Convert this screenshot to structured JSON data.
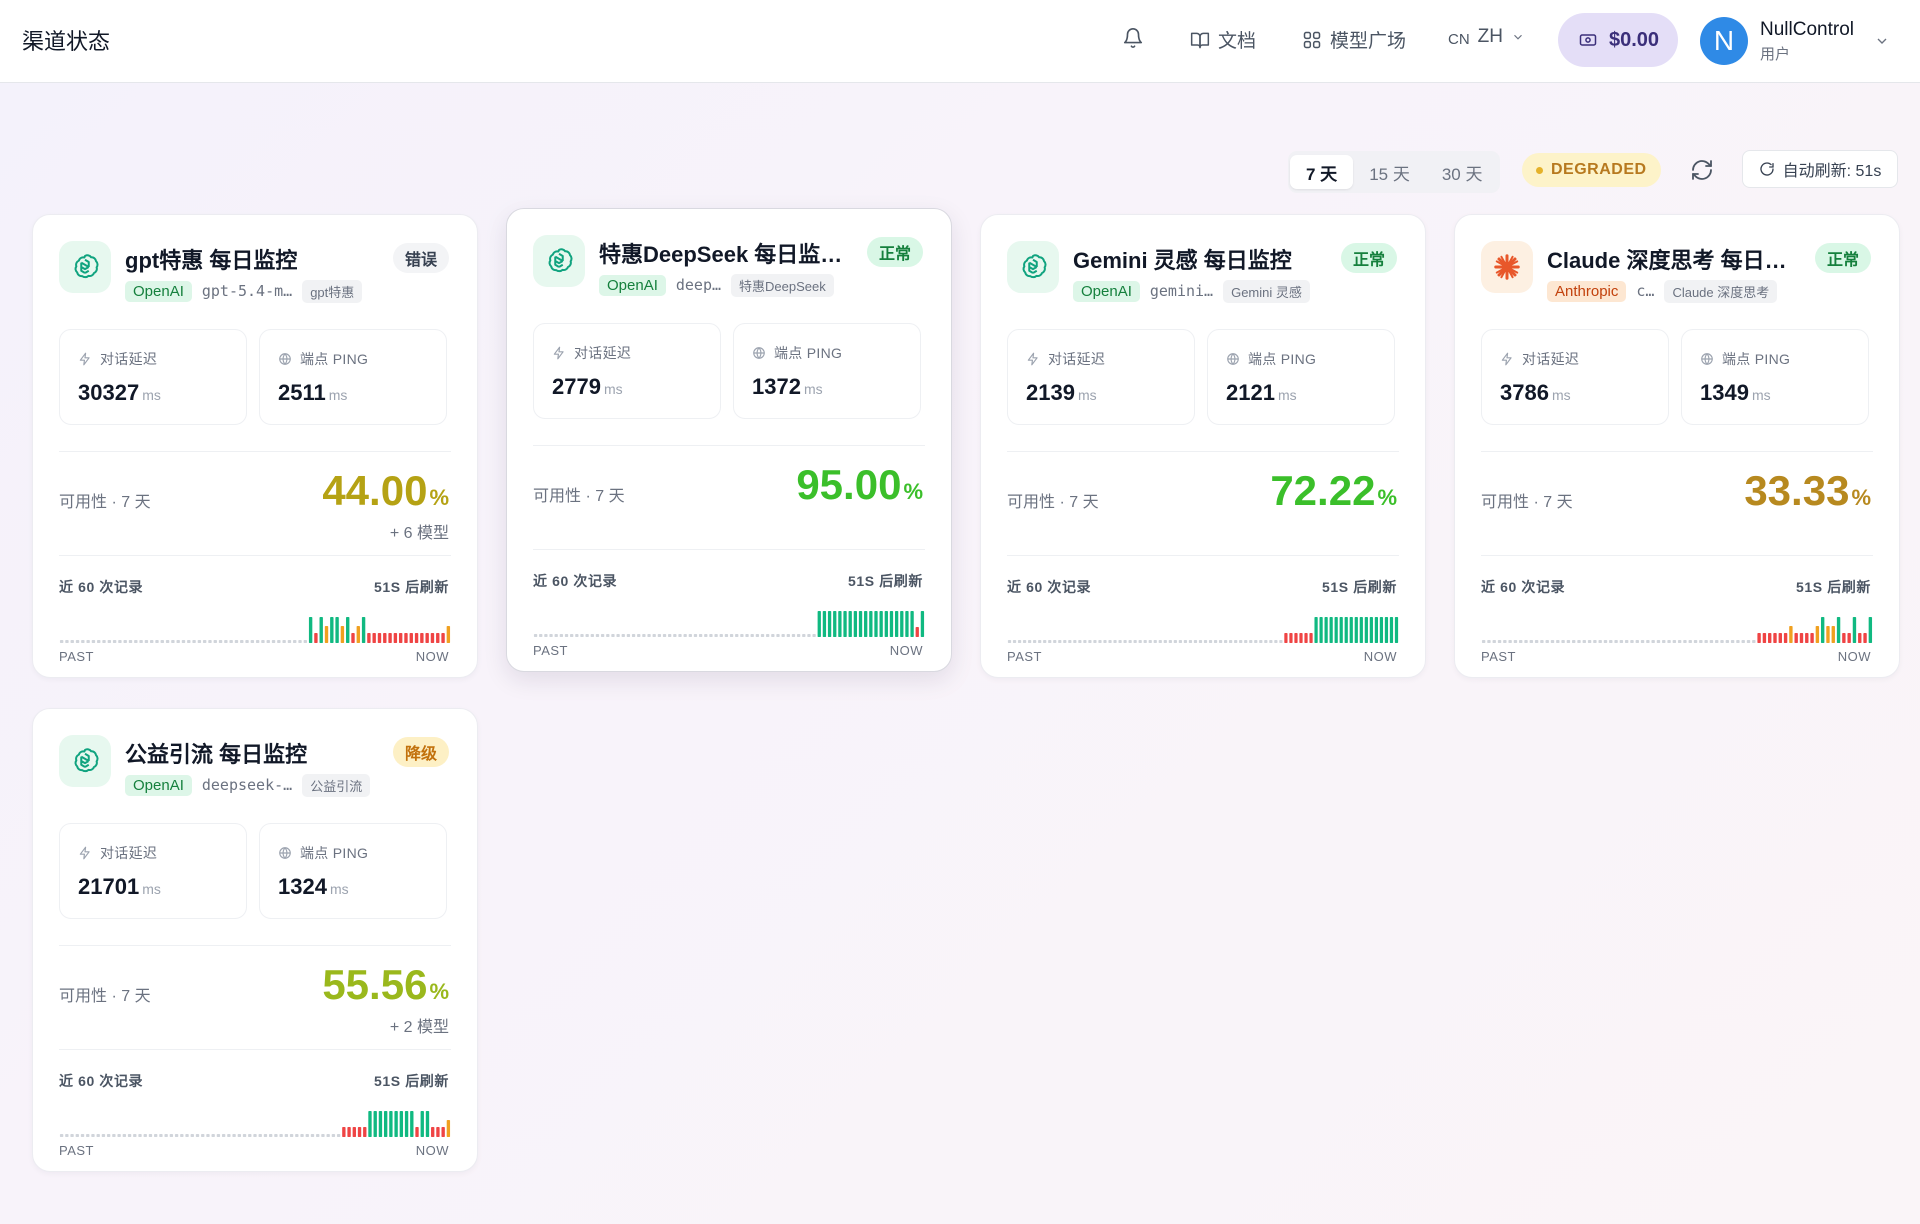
{
  "header": {
    "title": "渠道状态",
    "docs_label": "文档",
    "models_label": "模型广场",
    "lang_prefix": "CN",
    "lang_label": "ZH",
    "balance": "$0.00",
    "user_initial": "N",
    "user_name": "NullControl",
    "user_role": "用户"
  },
  "controls": {
    "ranges": [
      "7 天",
      "15 天",
      "30 天"
    ],
    "active_range": 0,
    "overall_status": "DEGRADED",
    "auto_refresh": "自动刷新: 51s"
  },
  "common": {
    "latency_label": "对话延迟",
    "ping_label": "端点 PING",
    "unit": "ms",
    "availability_label": "可用性 · 7 天",
    "records_label": "近 60 次记录",
    "refresh_label": "51S 后刷新",
    "past": "PAST",
    "now": "NOW",
    "pct": "%"
  },
  "colors": {
    "ok": "#10b981",
    "warn": "#f0a020",
    "error": "#ef4444",
    "empty": "#d1d5db"
  },
  "cards": [
    {
      "title": "gpt特惠 每日监控",
      "status": "错误",
      "status_type": "error",
      "provider": "OpenAI",
      "provider_type": "openai",
      "model": "gpt-5.4-m…",
      "channel": "gpt特惠",
      "latency": "30327",
      "ping": "2511",
      "availability": "44.00",
      "availability_color": "#b5a214",
      "extra": "+ 6 模型",
      "records": "EEEEEEEEEEEEEEEEEEEEEEEEEEEEEEEEEEEEEEEEEEEEEEEOxOWOOWOxWOxxxxxxxxxxxxxxxW"
    },
    {
      "title": "特惠DeepSeek 每日监…",
      "status": "正常",
      "status_type": "ok",
      "provider": "OpenAI",
      "provider_type": "openai",
      "model": "deep…",
      "channel": "特惠DeepSeek",
      "latency": "2779",
      "ping": "1372",
      "availability": "95.00",
      "availability_color": "#3bbf2a",
      "extra": "",
      "records": "EEEEEEEEEEEEEEEEEEEEEEEEEEEEEEEEEEEEEEEEEEEEEEEEEEEEEEEOOOOOOOOOOOOOOOOOOOxO"
    },
    {
      "title": "Gemini 灵感 每日监控",
      "status": "正常",
      "status_type": "ok",
      "provider": "OpenAI",
      "provider_type": "openai",
      "model": "gemini…",
      "channel": "Gemini 灵感",
      "latency": "2139",
      "ping": "2121",
      "availability": "72.22",
      "availability_color": "#3bbf2a",
      "extra": "",
      "records": "EEEEEEEEEEEEEEEEEEEEEEEEEEEEEEEEEEEEEEEEEEEEEEEEEEEEEEExxxxxxOOOOOOOOOOOOOOOOO"
    },
    {
      "title": "Claude 深度思考 每日…",
      "status": "正常",
      "status_type": "ok",
      "provider": "Anthropic",
      "provider_type": "anthropic",
      "model": "c…",
      "channel": "Claude 深度思考",
      "latency": "3786",
      "ping": "1349",
      "availability": "33.33",
      "availability_color": "#b7891f",
      "extra": "",
      "records": "EEEEEEEEEEEEEEEEEEEEEEEEEEEEEEEEEEEEEEEEEEEEEEEEEEEExxxxxxWxxxxWOWWOxxOxxO"
    },
    {
      "title": "公益引流 每日监控",
      "status": "降级",
      "status_type": "degraded",
      "provider": "OpenAI",
      "provider_type": "openai",
      "model": "deepseek-…",
      "channel": "公益引流",
      "latency": "21701",
      "ping": "1324",
      "availability": "55.56",
      "availability_color": "#9ab81c",
      "extra": "+ 2 模型",
      "records": "EEEEEEEEEEEEEEEEEEEEEEEEEEEEEEEEEEEEEEEEEEEEEEEEEEEEEExxxxxOOOOOOOOOxOOxxxW"
    }
  ]
}
